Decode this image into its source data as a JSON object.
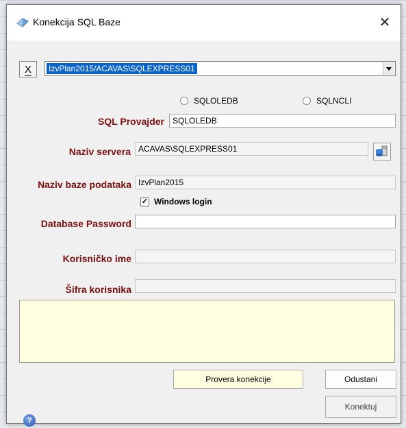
{
  "window": {
    "title": "Konekcija SQL Baze",
    "close_glyph": "✕"
  },
  "connection": {
    "clear_label": "X",
    "selected": "IzvPlan2015/ACAVAS\\SQLEXPRESS01"
  },
  "provider_options": [
    {
      "label": "SQLOLEDB",
      "selected": false
    },
    {
      "label": "SQLNCLI",
      "selected": false
    }
  ],
  "form": {
    "provider_label": "SQL Provajder",
    "provider_value": "SQLOLEDB",
    "server_label": "Naziv servera",
    "server_value": "ACAVAS\\SQLEXPRESS01",
    "database_label": "Naziv baze podataka",
    "database_value": "IzvPlan2015",
    "windows_login_label": "Windows login",
    "windows_login_checked": true,
    "password_label": "Database Password",
    "password_value": "",
    "username_label": "Korisničko ime",
    "username_value": "",
    "user_password_label": "Šifra korisnika",
    "user_password_value": ""
  },
  "buttons": {
    "test": "Provera konekcije",
    "cancel": "Odustani",
    "connect": "Konektuj"
  },
  "icons": {
    "title": "diamond-icon",
    "server_browse": "database-server-icon",
    "help": "help-icon"
  },
  "colors": {
    "label": "#7b0e0e",
    "selection": "#0a64c8",
    "message_bg": "#ffffe1",
    "test_button_bg": "#ffffe1"
  }
}
